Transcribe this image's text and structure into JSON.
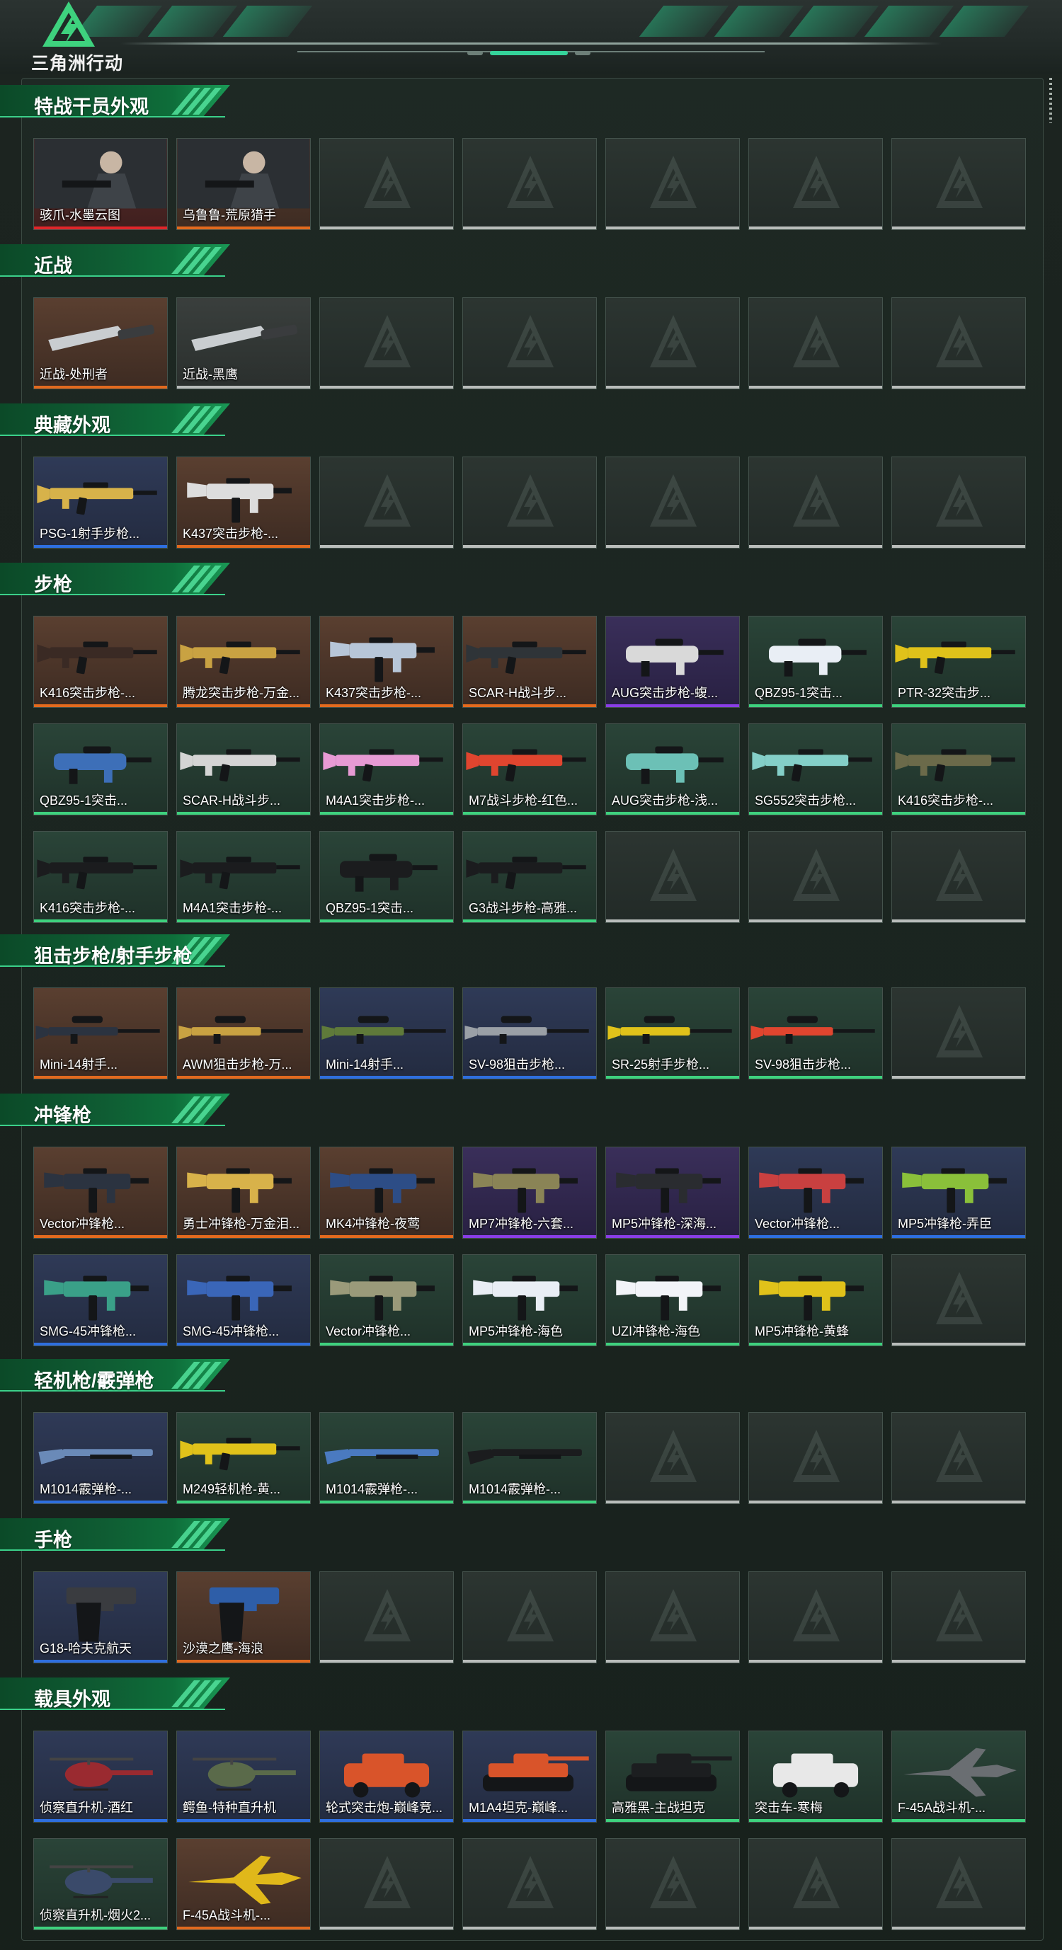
{
  "app": {
    "brand": "三角洲行动"
  },
  "colors": {
    "accent": "#3ed27e",
    "rarity": {
      "orange": "#e36a1e",
      "red": "#e0262a",
      "blue": "#2e6fe0",
      "purple": "#8a3ee6",
      "green": "#3ed27e",
      "white": "#b9bdbb"
    }
  },
  "sections": [
    {
      "title": "特战干员外观",
      "items": [
        {
          "label": "骇爪-水墨云图",
          "rarity": "red",
          "type": "operator"
        },
        {
          "label": "乌鲁鲁-荒原猎手",
          "rarity": "orange",
          "type": "operator"
        },
        {
          "label": "",
          "rarity": "empty"
        },
        {
          "label": "",
          "rarity": "empty"
        },
        {
          "label": "",
          "rarity": "empty"
        },
        {
          "label": "",
          "rarity": "empty"
        },
        {
          "label": "",
          "rarity": "empty"
        }
      ]
    },
    {
      "title": "近战",
      "items": [
        {
          "label": "近战-处刑者",
          "rarity": "orange",
          "type": "melee"
        },
        {
          "label": "近战-黑鹰",
          "rarity": "white",
          "type": "melee"
        },
        {
          "label": "",
          "rarity": "empty"
        },
        {
          "label": "",
          "rarity": "empty"
        },
        {
          "label": "",
          "rarity": "empty"
        },
        {
          "label": "",
          "rarity": "empty"
        },
        {
          "label": "",
          "rarity": "empty"
        }
      ]
    },
    {
      "title": "典藏外观",
      "items": [
        {
          "label": "PSG-1射手步枪...",
          "rarity": "blue",
          "type": "rifle",
          "skin": "#d7b24a"
        },
        {
          "label": "K437突击步枪-...",
          "rarity": "orange",
          "type": "smg",
          "skin": "#dddddd"
        },
        {
          "label": "",
          "rarity": "empty"
        },
        {
          "label": "",
          "rarity": "empty"
        },
        {
          "label": "",
          "rarity": "empty"
        },
        {
          "label": "",
          "rarity": "empty"
        },
        {
          "label": "",
          "rarity": "empty"
        }
      ]
    },
    {
      "title": "步枪",
      "items": [
        {
          "label": "K416突击步枪-...",
          "rarity": "orange",
          "type": "rifle",
          "skin": "#3a2a24"
        },
        {
          "label": "腾龙突击步枪-万金...",
          "rarity": "orange",
          "type": "rifle",
          "skin": "#c9a242"
        },
        {
          "label": "K437突击步枪-...",
          "rarity": "orange",
          "type": "smg",
          "skin": "#b7c6d8"
        },
        {
          "label": "SCAR-H战斗步...",
          "rarity": "orange",
          "type": "rifle",
          "skin": "#2f3438"
        },
        {
          "label": "AUG突击步枪-蝮...",
          "rarity": "purple",
          "type": "bullpup",
          "skin": "#d9d9d9"
        },
        {
          "label": "QBZ95-1突击...",
          "rarity": "green",
          "type": "bullpup",
          "skin": "#e9eef5"
        },
        {
          "label": "PTR-32突击步...",
          "rarity": "green",
          "type": "rifle",
          "skin": "#e0c21a"
        },
        {
          "label": "QBZ95-1突击...",
          "rarity": "green",
          "type": "bullpup",
          "skin": "#3d6fb8"
        },
        {
          "label": "SCAR-H战斗步...",
          "rarity": "green",
          "type": "rifle",
          "skin": "#d4d4d4"
        },
        {
          "label": "M4A1突击步枪-...",
          "rarity": "green",
          "type": "rifle",
          "skin": "#e79ad4"
        },
        {
          "label": "M7战斗步枪-红色...",
          "rarity": "green",
          "type": "rifle",
          "skin": "#e0452f"
        },
        {
          "label": "AUG突击步枪-浅...",
          "rarity": "green",
          "type": "bullpup",
          "skin": "#6cc0b6"
        },
        {
          "label": "SG552突击步枪...",
          "rarity": "green",
          "type": "rifle",
          "skin": "#84cfc8"
        },
        {
          "label": "K416突击步枪-...",
          "rarity": "green",
          "type": "rifle",
          "skin": "#6b6a4a"
        },
        {
          "label": "K416突击步枪-...",
          "rarity": "green",
          "type": "rifle",
          "skin": "#1b1c1e"
        },
        {
          "label": "M4A1突击步枪-...",
          "rarity": "green",
          "type": "rifle",
          "skin": "#1b1c1e"
        },
        {
          "label": "QBZ95-1突击...",
          "rarity": "green",
          "type": "bullpup",
          "skin": "#1b1c1e"
        },
        {
          "label": "G3战斗步枪-高雅...",
          "rarity": "green",
          "type": "rifle",
          "skin": "#1b1c1e"
        },
        {
          "label": "",
          "rarity": "empty"
        },
        {
          "label": "",
          "rarity": "empty"
        },
        {
          "label": "",
          "rarity": "empty"
        }
      ]
    },
    {
      "title": "狙击步枪/射手步枪",
      "items": [
        {
          "label": "Mini-14射手...",
          "rarity": "orange",
          "type": "sniper",
          "skin": "#2b3340"
        },
        {
          "label": "AWM狙击步枪-万...",
          "rarity": "orange",
          "type": "sniper",
          "skin": "#c9a242"
        },
        {
          "label": "Mini-14射手...",
          "rarity": "blue",
          "type": "sniper",
          "skin": "#5f7a3a"
        },
        {
          "label": "SV-98狙击步枪...",
          "rarity": "blue",
          "type": "sniper",
          "skin": "#9aa0a6"
        },
        {
          "label": "SR-25射手步枪...",
          "rarity": "green",
          "type": "sniper",
          "skin": "#e0c21a"
        },
        {
          "label": "SV-98狙击步枪...",
          "rarity": "green",
          "type": "sniper",
          "skin": "#e0452f"
        },
        {
          "label": "",
          "rarity": "empty"
        }
      ]
    },
    {
      "title": "冲锋枪",
      "items": [
        {
          "label": "Vector冲锋枪...",
          "rarity": "orange",
          "type": "smg",
          "skin": "#2b3340"
        },
        {
          "label": "勇士冲锋枪-万金泪...",
          "rarity": "orange",
          "type": "smg",
          "skin": "#d8b24a"
        },
        {
          "label": "MK4冲锋枪-夜莺",
          "rarity": "orange",
          "type": "smg",
          "skin": "#2d4d86"
        },
        {
          "label": "MP7冲锋枪-六套...",
          "rarity": "purple",
          "type": "smg",
          "skin": "#8a8456"
        },
        {
          "label": "MP5冲锋枪-深海...",
          "rarity": "purple",
          "type": "smg",
          "skin": "#2a2c30"
        },
        {
          "label": "Vector冲锋枪...",
          "rarity": "blue",
          "type": "smg",
          "skin": "#c94040"
        },
        {
          "label": "MP5冲锋枪-弄臣",
          "rarity": "blue",
          "type": "smg",
          "skin": "#8ac03a"
        },
        {
          "label": "SMG-45冲锋枪...",
          "rarity": "blue",
          "type": "smg",
          "skin": "#3aa088"
        },
        {
          "label": "SMG-45冲锋枪...",
          "rarity": "blue",
          "type": "smg",
          "skin": "#3a66b8"
        },
        {
          "label": "Vector冲锋枪...",
          "rarity": "green",
          "type": "smg",
          "skin": "#9a9a7a"
        },
        {
          "label": "MP5冲锋枪-海色",
          "rarity": "green",
          "type": "smg",
          "skin": "#e9eef5"
        },
        {
          "label": "UZI冲锋枪-海色",
          "rarity": "green",
          "type": "smg",
          "skin": "#f2f4f8"
        },
        {
          "label": "MP5冲锋枪-黄蜂",
          "rarity": "green",
          "type": "smg",
          "skin": "#e0c21a"
        },
        {
          "label": "",
          "rarity": "empty"
        }
      ]
    },
    {
      "title": "轻机枪/霰弹枪",
      "items": [
        {
          "label": "M1014霰弹枪-...",
          "rarity": "blue",
          "type": "shotgun",
          "skin": "#6a8ab8"
        },
        {
          "label": "M249轻机枪-黄...",
          "rarity": "green",
          "type": "rifle",
          "skin": "#e0c21a"
        },
        {
          "label": "M1014霰弹枪-...",
          "rarity": "green",
          "type": "shotgun",
          "skin": "#4a7ac0"
        },
        {
          "label": "M1014霰弹枪-...",
          "rarity": "green",
          "type": "shotgun",
          "skin": "#1b1c1e"
        },
        {
          "label": "",
          "rarity": "empty"
        },
        {
          "label": "",
          "rarity": "empty"
        },
        {
          "label": "",
          "rarity": "empty"
        }
      ]
    },
    {
      "title": "手枪",
      "items": [
        {
          "label": "G18-哈夫克航天",
          "rarity": "blue",
          "type": "pistol",
          "skin": "#3a3c40"
        },
        {
          "label": "沙漠之鹰-海浪",
          "rarity": "orange",
          "type": "pistol",
          "skin": "#2e5ea8"
        },
        {
          "label": "",
          "rarity": "empty"
        },
        {
          "label": "",
          "rarity": "empty"
        },
        {
          "label": "",
          "rarity": "empty"
        },
        {
          "label": "",
          "rarity": "empty"
        },
        {
          "label": "",
          "rarity": "empty"
        }
      ]
    },
    {
      "title": "载具外观",
      "items": [
        {
          "label": "侦察直升机-酒红",
          "rarity": "blue",
          "type": "heli",
          "skin": "#9a2a30"
        },
        {
          "label": "鳄鱼-特种直升机",
          "rarity": "blue",
          "type": "heli",
          "skin": "#5a6a4a"
        },
        {
          "label": "轮式突击炮-巅峰竞...",
          "rarity": "blue",
          "type": "car",
          "skin": "#d9542a"
        },
        {
          "label": "M1A4坦克-巅峰...",
          "rarity": "blue",
          "type": "tank",
          "skin": "#d9542a"
        },
        {
          "label": "高雅黑-主战坦克",
          "rarity": "green",
          "type": "tank",
          "skin": "#1c1e20"
        },
        {
          "label": "突击车-寒梅",
          "rarity": "green",
          "type": "car",
          "skin": "#e8e8e8"
        },
        {
          "label": "F-45A战斗机-...",
          "rarity": "green",
          "type": "jet",
          "skin": "#6a6e72"
        },
        {
          "label": "侦察直升机-烟火2...",
          "rarity": "green",
          "type": "heli",
          "skin": "#3a4a6a"
        },
        {
          "label": "F-45A战斗机-...",
          "rarity": "orange",
          "type": "jet",
          "skin": "#e0b81a"
        },
        {
          "label": "",
          "rarity": "empty"
        },
        {
          "label": "",
          "rarity": "empty"
        },
        {
          "label": "",
          "rarity": "empty"
        },
        {
          "label": "",
          "rarity": "empty"
        },
        {
          "label": "",
          "rarity": "empty"
        }
      ]
    }
  ]
}
